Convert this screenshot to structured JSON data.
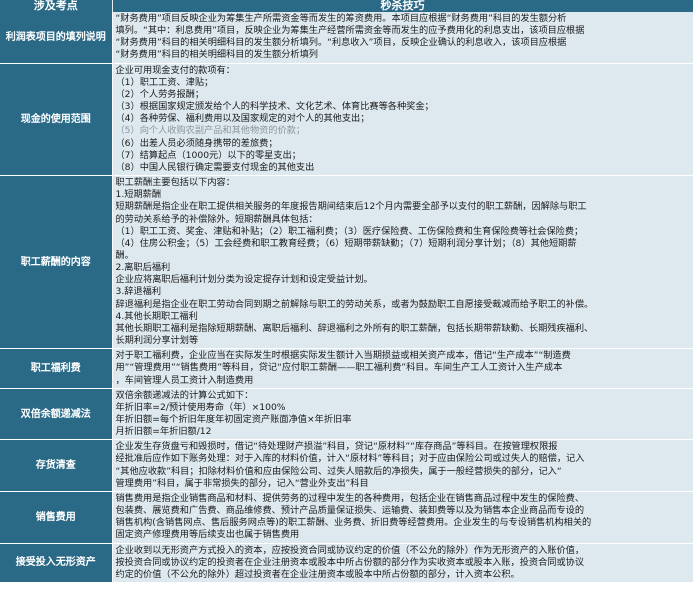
{
  "header": {
    "col1": "涉及考点",
    "col2": "秒杀技巧"
  },
  "rows": [
    {
      "topic": "利润表项目的填列说明",
      "lines": [
        "“财务费用”项目反映企业为筹集生产所需资金等而发生的筹资费用。本项目应根据“财务费用”科目的发生额分析",
        "填列。“其中：利息费用”项目，反映企业为筹集生产经营所需资金等而发生的应予费用化的利息支出，该项目应根据",
        "“财务费用”科目的相关明细科目的发生额分析填列。“利息收入”项目，反映企业确认的利息收入，该项目应根据",
        "“财务费用”科目的相关明细科目的发生额分析填列"
      ]
    },
    {
      "topic": "现金的使用范围",
      "lines": [
        "企业可用现金支付的款项有：",
        "（1）职工工资、津贴；",
        "（2）个人劳务报酬；",
        "（3）根据国家规定颁发给个人的科学技术、文化艺术、体育比赛等各种奖金；",
        "（4）各种劳保、福利费用以及国家规定的对个人的其他支出；",
        "（5）向个人收购农副产品和其他物资的价款；",
        "（6）出差人员必须随身携带的差旅费；",
        "（7）结算起点（1000元）以下的零星支出；",
        "（8）中国人民银行确定需要支付现金的其他支出"
      ]
    },
    {
      "topic": "职工薪酬的内容",
      "lines": [
        "职工薪酬主要包括以下内容：",
        "1.短期薪酬",
        "短期薪酬是指企业在职工提供相关服务的年度报告期间结束后12个月内需要全部予以支付的职工薪酬，因解除与职工",
        "的劳动关系给予的补偿除外。短期薪酬具体包括：",
        "（1）职工工资、奖金、津贴和补贴；（2）职工福利费；（3）医疗保险费、工伤保险费和生育保险费等社会保险费；",
        "（4）住房公积金；（5）工会经费和职工教育经费；（6）短期带薪缺勤；（7）短期利润分享计划；（8）其他短期薪",
        "酬。",
        "2.离职后福利",
        "企业应将离职后福利计划分类为设定提存计划和设定受益计划。",
        "3.辞退福利",
        "辞退福利是指企业在职工劳动合同到期之前解除与职工的劳动关系，或者为鼓励职工自愿接受裁减而给予职工的补偿。",
        "4.其他长期职工福利",
        "其他长期职工福利是指除短期薪酬、离职后福利、辞退福利之外所有的职工薪酬，包括长期带薪缺勤、长期残疾福利、",
        "长期利润分享计划等"
      ]
    },
    {
      "topic": "职工福利费",
      "lines": [
        "对于职工福利费，企业应当在实际发生时根据实际发生额计入当期损益或相关资产成本，借记“生产成本”“制造费",
        "用”“管理费用”“销售费用”等科目，贷记“应付职工薪酬——职工福利费”科目。车间生产工人工资计入生产成本",
        "，车间管理人员工资计入制造费用"
      ]
    },
    {
      "topic": "双倍余额递减法",
      "lines": [
        "双倍余额递减法的计算公式如下：",
        "年折旧率=2/预计使用寿命（年）×100%",
        "年折旧额=每个折旧年度年初固定资产账面净值×年折旧率",
        "月折旧额=年折旧额/12"
      ]
    },
    {
      "topic": "存货清查",
      "lines": [
        "企业发生存货盘亏和毁损时，借记“待处理财产损溢”科目，贷记“原材料”“库存商品”等科目。在按管理权限报",
        "经批准后应作如下账务处理：对于入库的材料价值，计入“原材料”等科目；对于应由保险公司或过失人的赔偿，记入",
        "“其他应收款”科目；扣除材料价值和应由保险公司、过失人赔款后的净损失，属于一般经营损失的部分，记入“",
        "管理费用”科目，属于非常损失的部分，记入“营业外支出”科目"
      ]
    },
    {
      "topic": "销售费用",
      "lines": [
        "销售费用是指企业销售商品和材料、提供劳务的过程中发生的各种费用，包括企业在销售商品过程中发生的保险费、",
        "包装费、展览费和广告费、商品维修费、预计产品质量保证损失、运输费、装卸费等以及为销售本企业商品而专设的",
        "销售机构(含销售网点、售后服务网点等)的职工薪酬、业务费、折旧费等经营费用。企业发生的与专设销售机构相关的",
        "固定资产修理费用等后续支出也属于销售费用"
      ]
    },
    {
      "topic": "接受投入无形资产",
      "lines": [
        "企业收到以无形资产方式投入的资本，应按投资合同或协议约定的价值（不公允的除外）作为无形资产的入账价值，",
        "按投资合同或协议约定的投资者在企业注册资本或股本中所占份额的部分作为实收资本或股本入账，投资合同或协议",
        "约定的价值（不公允的除外）超过投资者在企业注册资本或股本中所占份额的部分，计入资本公积。"
      ]
    }
  ]
}
